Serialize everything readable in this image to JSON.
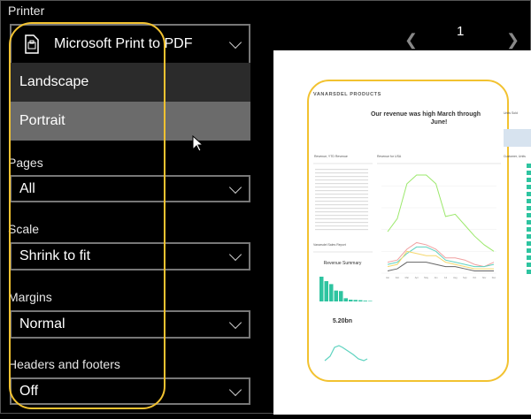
{
  "settings": {
    "printer": {
      "label": "Printer",
      "value": "Microsoft Print to PDF",
      "icon": "printer-icon"
    },
    "orientation_options": [
      {
        "label": "Landscape",
        "highlighted": false
      },
      {
        "label": "Portrait",
        "highlighted": true
      }
    ],
    "pages": {
      "label": "Pages",
      "value": "All"
    },
    "scale": {
      "label": "Scale",
      "value": "Shrink to fit"
    },
    "margins": {
      "label": "Margins",
      "value": "Normal"
    },
    "headers_footers": {
      "label": "Headers and footers",
      "value": "Off"
    }
  },
  "preview": {
    "page_number": "1",
    "brand": "VANARSDEL PRODUCTS",
    "headline": "Our revenue was high March through June!",
    "tiles": {
      "ytd": "Revenue, YTD Revenue",
      "usa": "Revenue for USA",
      "units_sold": "Units Sold",
      "customer_units": "Customer, Units",
      "sales_report": "Vanarsdel Sales Report",
      "summary": "Revenue Summary",
      "kpi": "5.20bn"
    },
    "months": [
      "Jan",
      "Feb",
      "Mar",
      "Apr",
      "May",
      "Jun",
      "Jul",
      "Aug",
      "Sep",
      "Oct",
      "Nov",
      "Dec"
    ],
    "series": [
      {
        "color": "#9be86b",
        "values": [
          1.9,
          2.5,
          4.1,
          4.5,
          4.5,
          4.1,
          2.6,
          2.7,
          2.2,
          1.7,
          1.3,
          1.0
        ]
      },
      {
        "color": "#f0a0a0",
        "values": [
          0.5,
          0.6,
          1.1,
          1.4,
          1.3,
          1.1,
          0.7,
          0.7,
          0.6,
          0.4,
          0.3,
          0.5
        ]
      },
      {
        "color": "#5fd3c0",
        "values": [
          0.4,
          0.5,
          0.9,
          1.2,
          1.2,
          1.0,
          0.6,
          0.5,
          0.4,
          0.3,
          0.3,
          0.4
        ]
      },
      {
        "color": "#f5d76e",
        "values": [
          0.3,
          0.4,
          1.0,
          0.9,
          0.8,
          0.8,
          0.5,
          0.4,
          0.3,
          0.2,
          0.2,
          0.2
        ]
      },
      {
        "color": "#666666",
        "values": [
          0.1,
          0.2,
          0.5,
          0.5,
          0.5,
          0.4,
          0.3,
          0.3,
          0.2,
          0.1,
          0.1,
          0.1
        ]
      }
    ],
    "bars": [
      1,
      0.82,
      0.7,
      0.44,
      0.42,
      0.13,
      0.07,
      0.06,
      0.05,
      0.03,
      0.02
    ],
    "accent": "#f2c230"
  }
}
